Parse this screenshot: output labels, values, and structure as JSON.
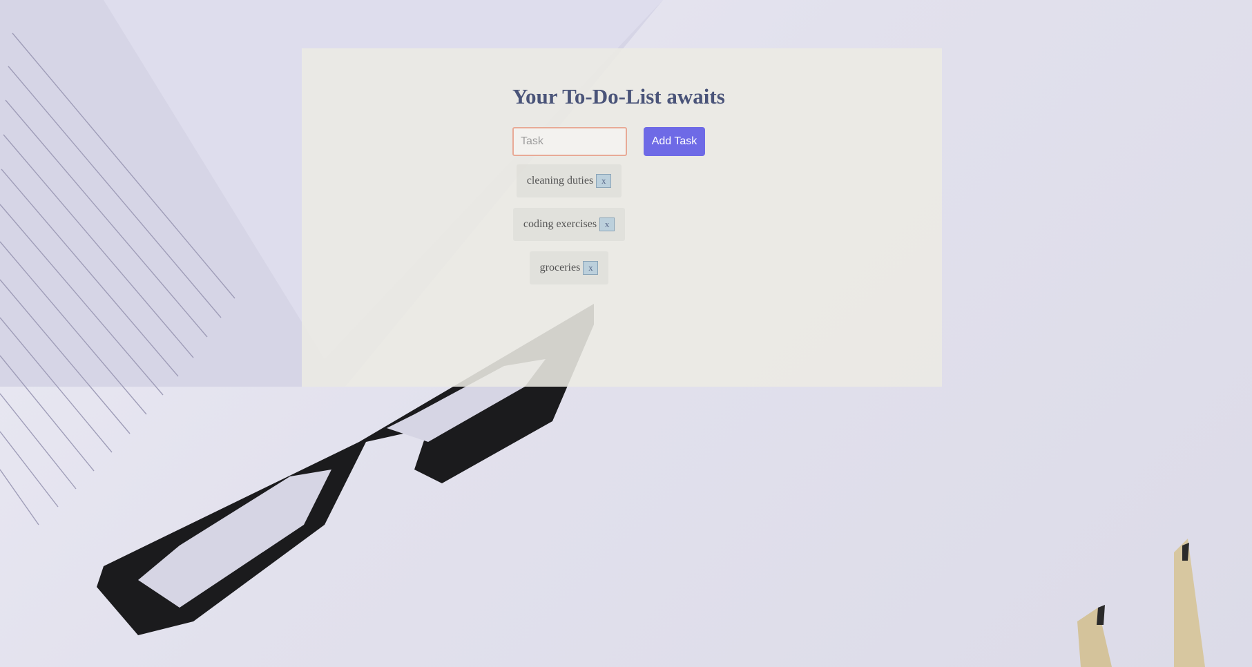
{
  "page": {
    "title": "Your To-Do-List awaits"
  },
  "form": {
    "input_placeholder": "Task",
    "input_value": "",
    "add_button_label": "Add Task"
  },
  "tasks": [
    {
      "text": "cleaning duties",
      "remove_label": "x"
    },
    {
      "text": "coding exercises",
      "remove_label": "x"
    },
    {
      "text": "groceries",
      "remove_label": "x"
    }
  ],
  "colors": {
    "title": "#4a5479",
    "accent_button": "#6e6ae6",
    "input_border": "#e8aa96",
    "remove_button": "#bcd0dc"
  }
}
